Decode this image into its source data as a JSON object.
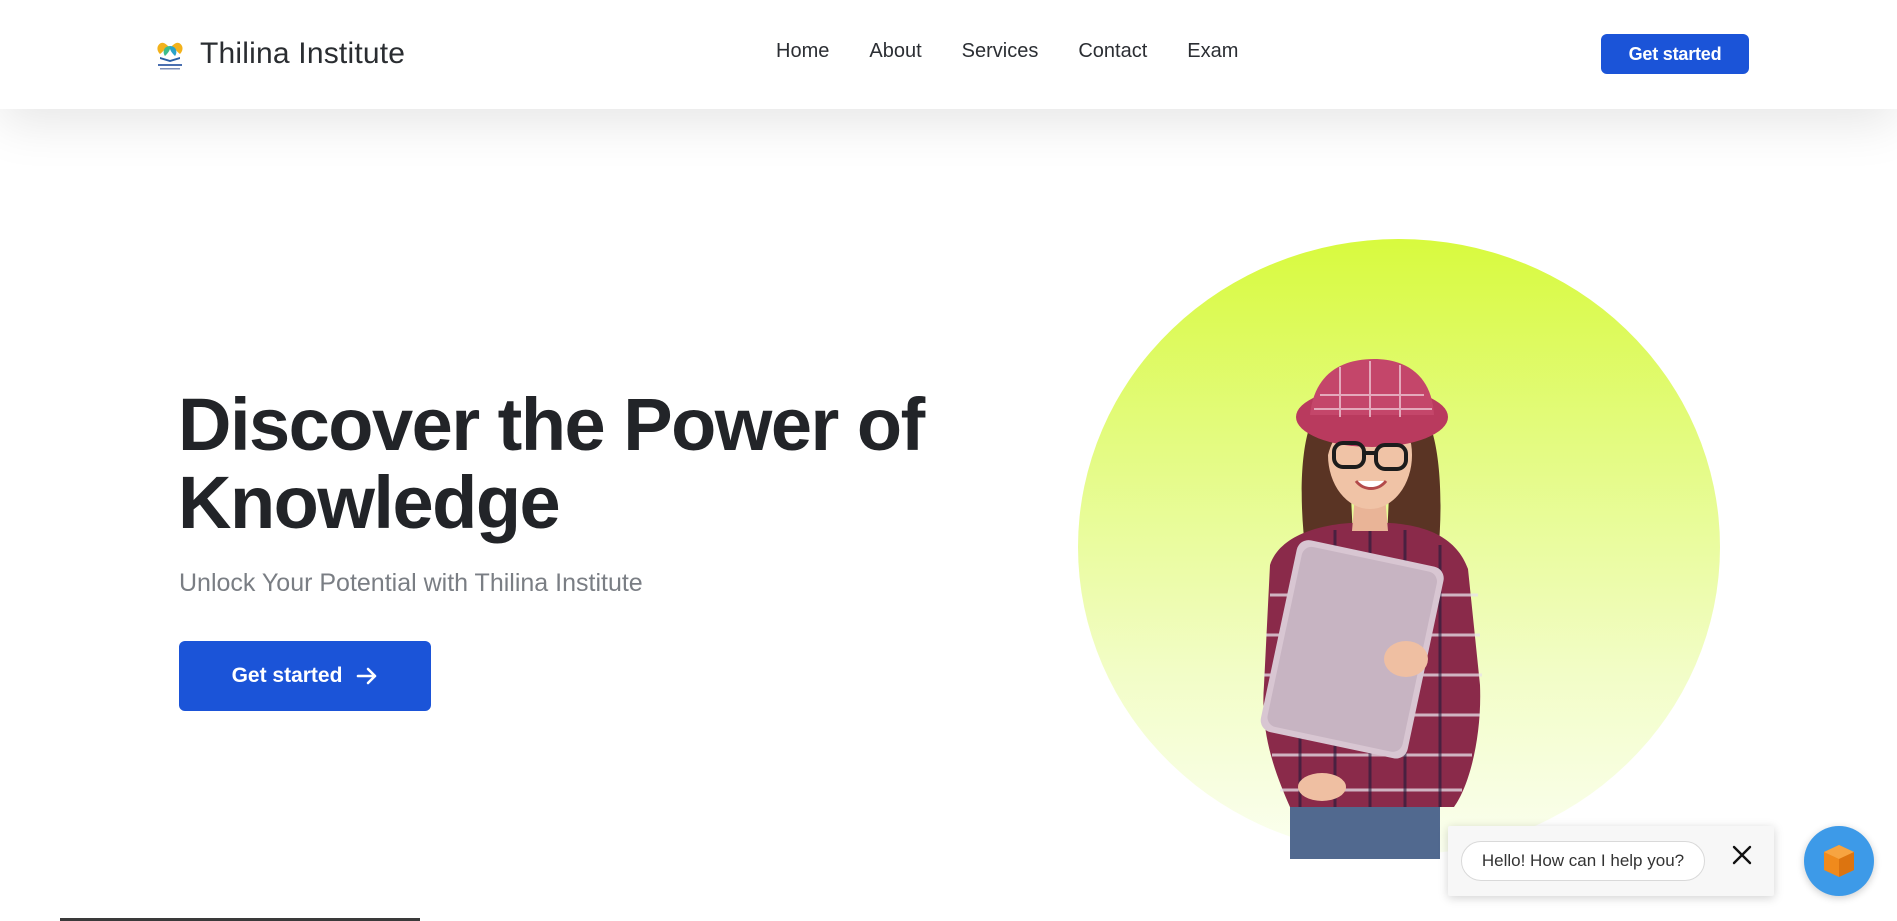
{
  "header": {
    "brand_name": "Thilina Institute",
    "logo_icon": "open-book-leaf-logo",
    "nav": [
      "Home",
      "About",
      "Services",
      "Contact",
      "Exam"
    ],
    "cta_label": "Get started"
  },
  "hero": {
    "title": "Discover the Power of Knowledge",
    "subtitle": "Unlock Your Potential with Thilina Institute",
    "cta_label": "Get started",
    "cta_icon": "arrow-right-icon",
    "image": "student-holding-laptop",
    "circle_colors": [
      "#d8fa3e",
      "#fbfff0"
    ]
  },
  "chat": {
    "greeting": "Hello! How can I help you?",
    "close_icon": "close-icon",
    "launcher_icon": "cube-icon"
  },
  "colors": {
    "accent": "#1b54d8",
    "chat_launcher": "#3d9ae8",
    "cube": "#f08a1c"
  }
}
